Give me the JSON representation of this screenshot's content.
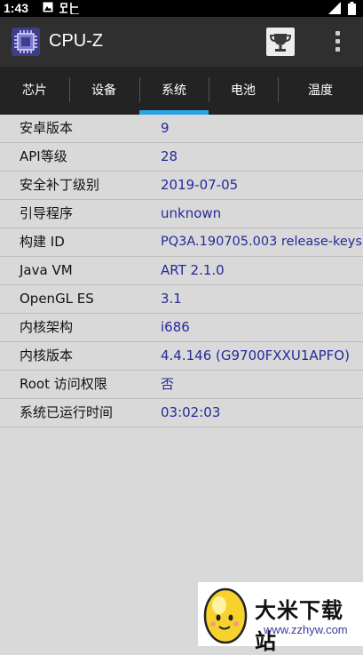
{
  "status_bar": {
    "time": "1:43"
  },
  "app_bar": {
    "title": "CPU-Z"
  },
  "tabs": [
    {
      "label": "芯片"
    },
    {
      "label": "设备"
    },
    {
      "label": "系统",
      "active": true
    },
    {
      "label": "电池"
    },
    {
      "label": "温度"
    }
  ],
  "system_info": [
    {
      "label": "安卓版本",
      "value": "9"
    },
    {
      "label": "API等级",
      "value": "28"
    },
    {
      "label": "安全补丁级别",
      "value": "2019-07-05"
    },
    {
      "label": "引导程序",
      "value": "unknown"
    },
    {
      "label": "构建 ID",
      "value": "PQ3A.190705.003 release-keys"
    },
    {
      "label": "Java VM",
      "value": "ART 2.1.0"
    },
    {
      "label": "OpenGL ES",
      "value": "3.1"
    },
    {
      "label": "内核架构",
      "value": "i686"
    },
    {
      "label": "内核版本",
      "value": "4.4.146 (G9700FXXU1APFO)"
    },
    {
      "label": "Root 访问权限",
      "value": "否"
    },
    {
      "label": "系统已运行时间",
      "value": "03:02:03"
    }
  ],
  "watermark": {
    "title": "大米下载站",
    "url": "www.zzhyw.com"
  },
  "colors": {
    "app_bar": "#2f2f2f",
    "tab_bar": "#232323",
    "tab_indicator": "#29a3e3",
    "value_text": "#262a9a",
    "background": "#d9d9d9"
  }
}
